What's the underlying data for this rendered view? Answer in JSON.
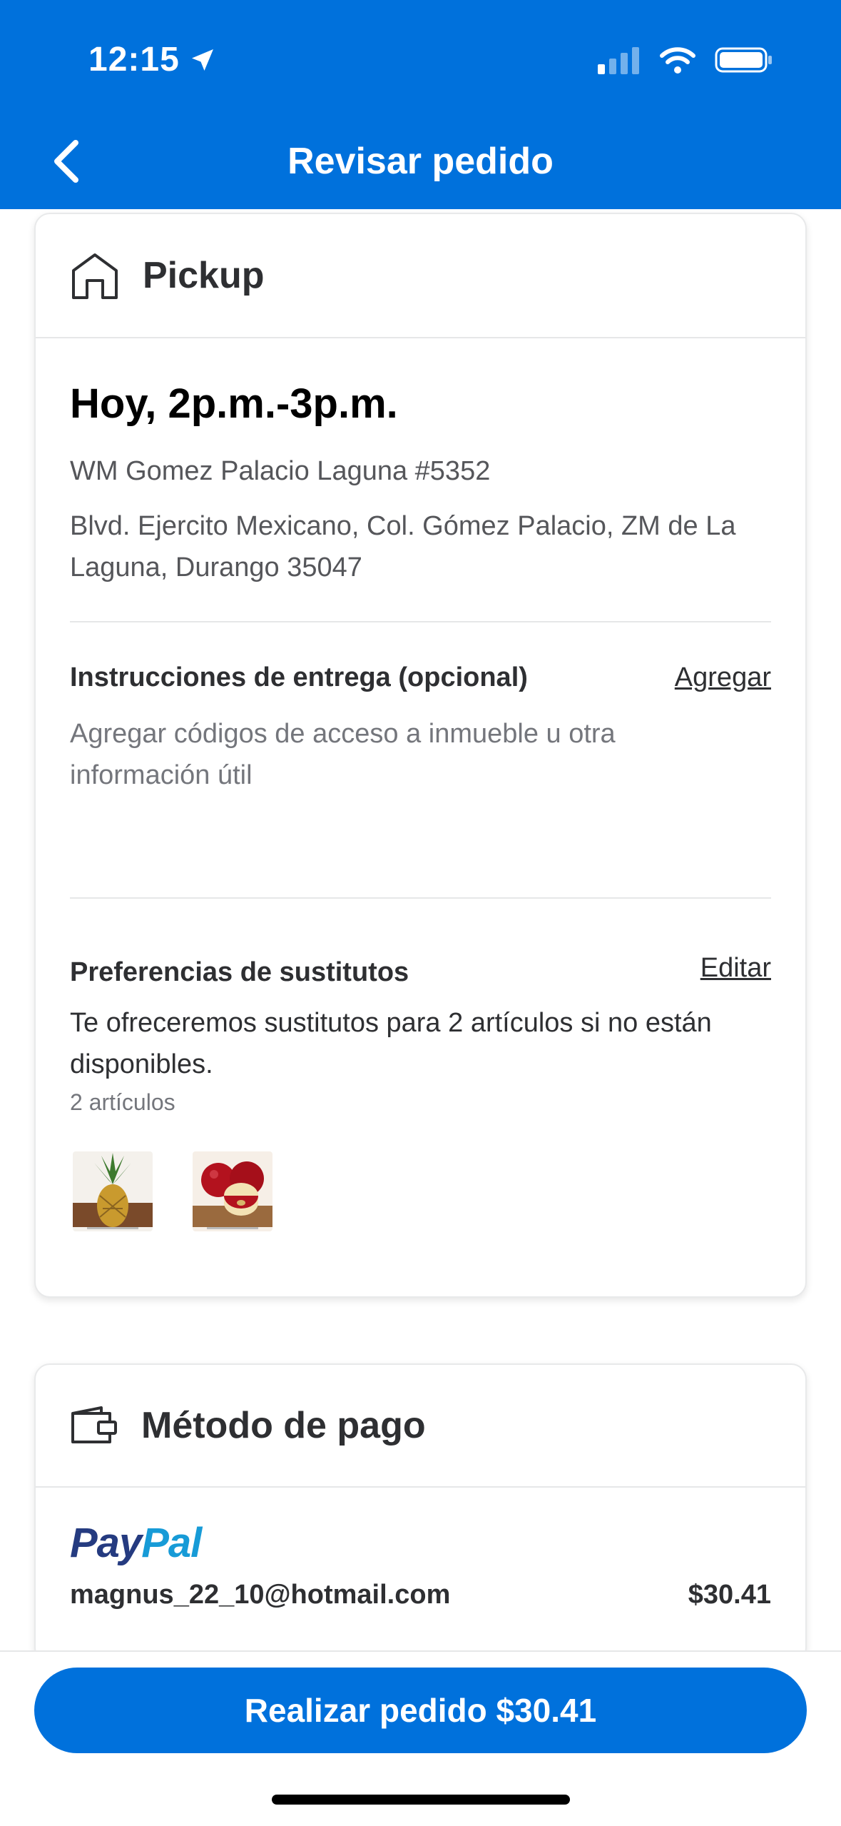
{
  "status_bar": {
    "time": "12:15"
  },
  "header": {
    "title": "Revisar pedido"
  },
  "pickup_card": {
    "title": "Pickup",
    "slot": "Hoy, 2p.m.-3p.m.",
    "store_name": "WM Gomez Palacio Laguna #5352",
    "address": "Blvd. Ejercito Mexicano, Col. Gómez Palacio, ZM de La Laguna, Durango 35047",
    "instructions": {
      "title": "Instrucciones de entrega (opcional)",
      "action": "Agregar",
      "placeholder": "Agregar códigos de acceso a inmueble u otra información útil"
    },
    "substitutes": {
      "title": "Preferencias de sustitutos",
      "action": "Editar",
      "description": "Te ofreceremos sustitutos para 2 artículos si no están disponibles.",
      "count": "2 artículos",
      "items": [
        "pineapple-image",
        "apples-image"
      ]
    }
  },
  "payment_card": {
    "title": "Método de pago",
    "provider_pay": "Pay",
    "provider_pal": "Pal",
    "email": "magnus_22_10@hotmail.com",
    "amount": "$30.41"
  },
  "footer": {
    "cta": "Realizar pedido $30.41"
  },
  "colors": {
    "brand_blue": "#0071dc",
    "paypal_dark": "#253b80",
    "paypal_light": "#179bd7"
  }
}
